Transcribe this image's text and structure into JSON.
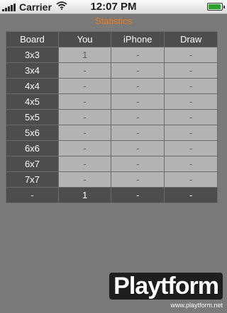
{
  "status_bar": {
    "carrier": "Carrier",
    "time": "12:07 PM"
  },
  "title": "Statistics",
  "table": {
    "headers": [
      "Board",
      "You",
      "iPhone",
      "Draw"
    ],
    "rows": [
      {
        "board": "3x3",
        "you": "1",
        "iphone": "-",
        "draw": "-"
      },
      {
        "board": "3x4",
        "you": "-",
        "iphone": "-",
        "draw": "-"
      },
      {
        "board": "4x4",
        "you": "-",
        "iphone": "-",
        "draw": "-"
      },
      {
        "board": "4x5",
        "you": "-",
        "iphone": "-",
        "draw": "-"
      },
      {
        "board": "5x5",
        "you": "-",
        "iphone": "-",
        "draw": "-"
      },
      {
        "board": "5x6",
        "you": "-",
        "iphone": "-",
        "draw": "-"
      },
      {
        "board": "6x6",
        "you": "-",
        "iphone": "-",
        "draw": "-"
      },
      {
        "board": "6x7",
        "you": "-",
        "iphone": "-",
        "draw": "-"
      },
      {
        "board": "7x7",
        "you": "-",
        "iphone": "-",
        "draw": "-"
      }
    ],
    "totals": {
      "board": "-",
      "you": "1",
      "iphone": "-",
      "draw": "-"
    }
  },
  "watermark": {
    "word": "Playtform",
    "url": "www.playtform.net"
  },
  "colors": {
    "title": "#f07c1c",
    "header_bg": "#4d4d4d",
    "cell_bg": "#b3b3b3",
    "page_bg": "#7a7a7a"
  }
}
